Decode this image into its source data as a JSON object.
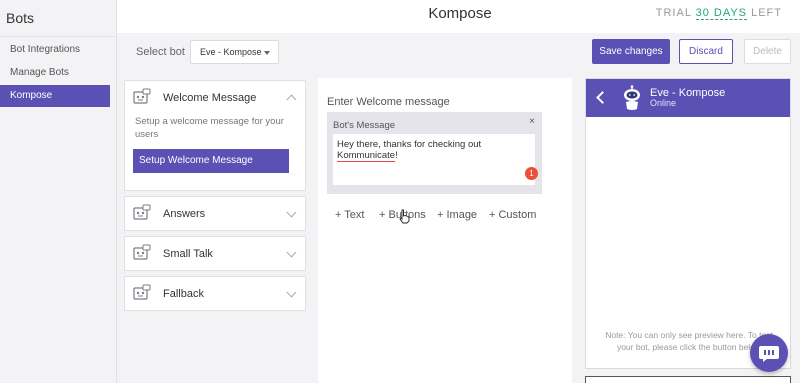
{
  "sidebar": {
    "title": "Bots",
    "items": [
      {
        "label": "Bot Integrations"
      },
      {
        "label": "Manage Bots"
      },
      {
        "label": "Kompose"
      }
    ]
  },
  "header": {
    "title": "Kompose",
    "trial_prefix": "TRIAL",
    "trial_days": "30 DAYS",
    "trial_suffix": "LEFT"
  },
  "toolbar": {
    "select_label": "Select bot",
    "selected_bot": "Eve - Kompose",
    "save_label": "Save changes",
    "discard_label": "Discard",
    "delete_label": "Delete"
  },
  "sections": [
    {
      "label": "Welcome Message",
      "description": "Setup a welcome message for your users",
      "button": "Setup Welcome Message",
      "expanded": true
    },
    {
      "label": "Answers"
    },
    {
      "label": "Small Talk"
    },
    {
      "label": "Fallback"
    }
  ],
  "editor": {
    "label": "Enter Welcome message",
    "box_caption": "Bot's Message",
    "close_symbol": "×",
    "message_prefix": "Hey there, thanks for checking out ",
    "message_spell": "Kommunicate",
    "message_suffix": "!",
    "badge_count": "1",
    "add_text": "+ Text",
    "add_buttons": "+ Buttons",
    "add_image": "+ Image",
    "add_custom": "+ Custom"
  },
  "preview": {
    "bot_name": "Eve - Kompose",
    "status": "Online",
    "note": "Note: You can only see preview here. To test your bot, please click the button below"
  },
  "colors": {
    "accent": "#5b51b4",
    "trial_green": "#21a870",
    "badge_red": "#e8503a"
  }
}
